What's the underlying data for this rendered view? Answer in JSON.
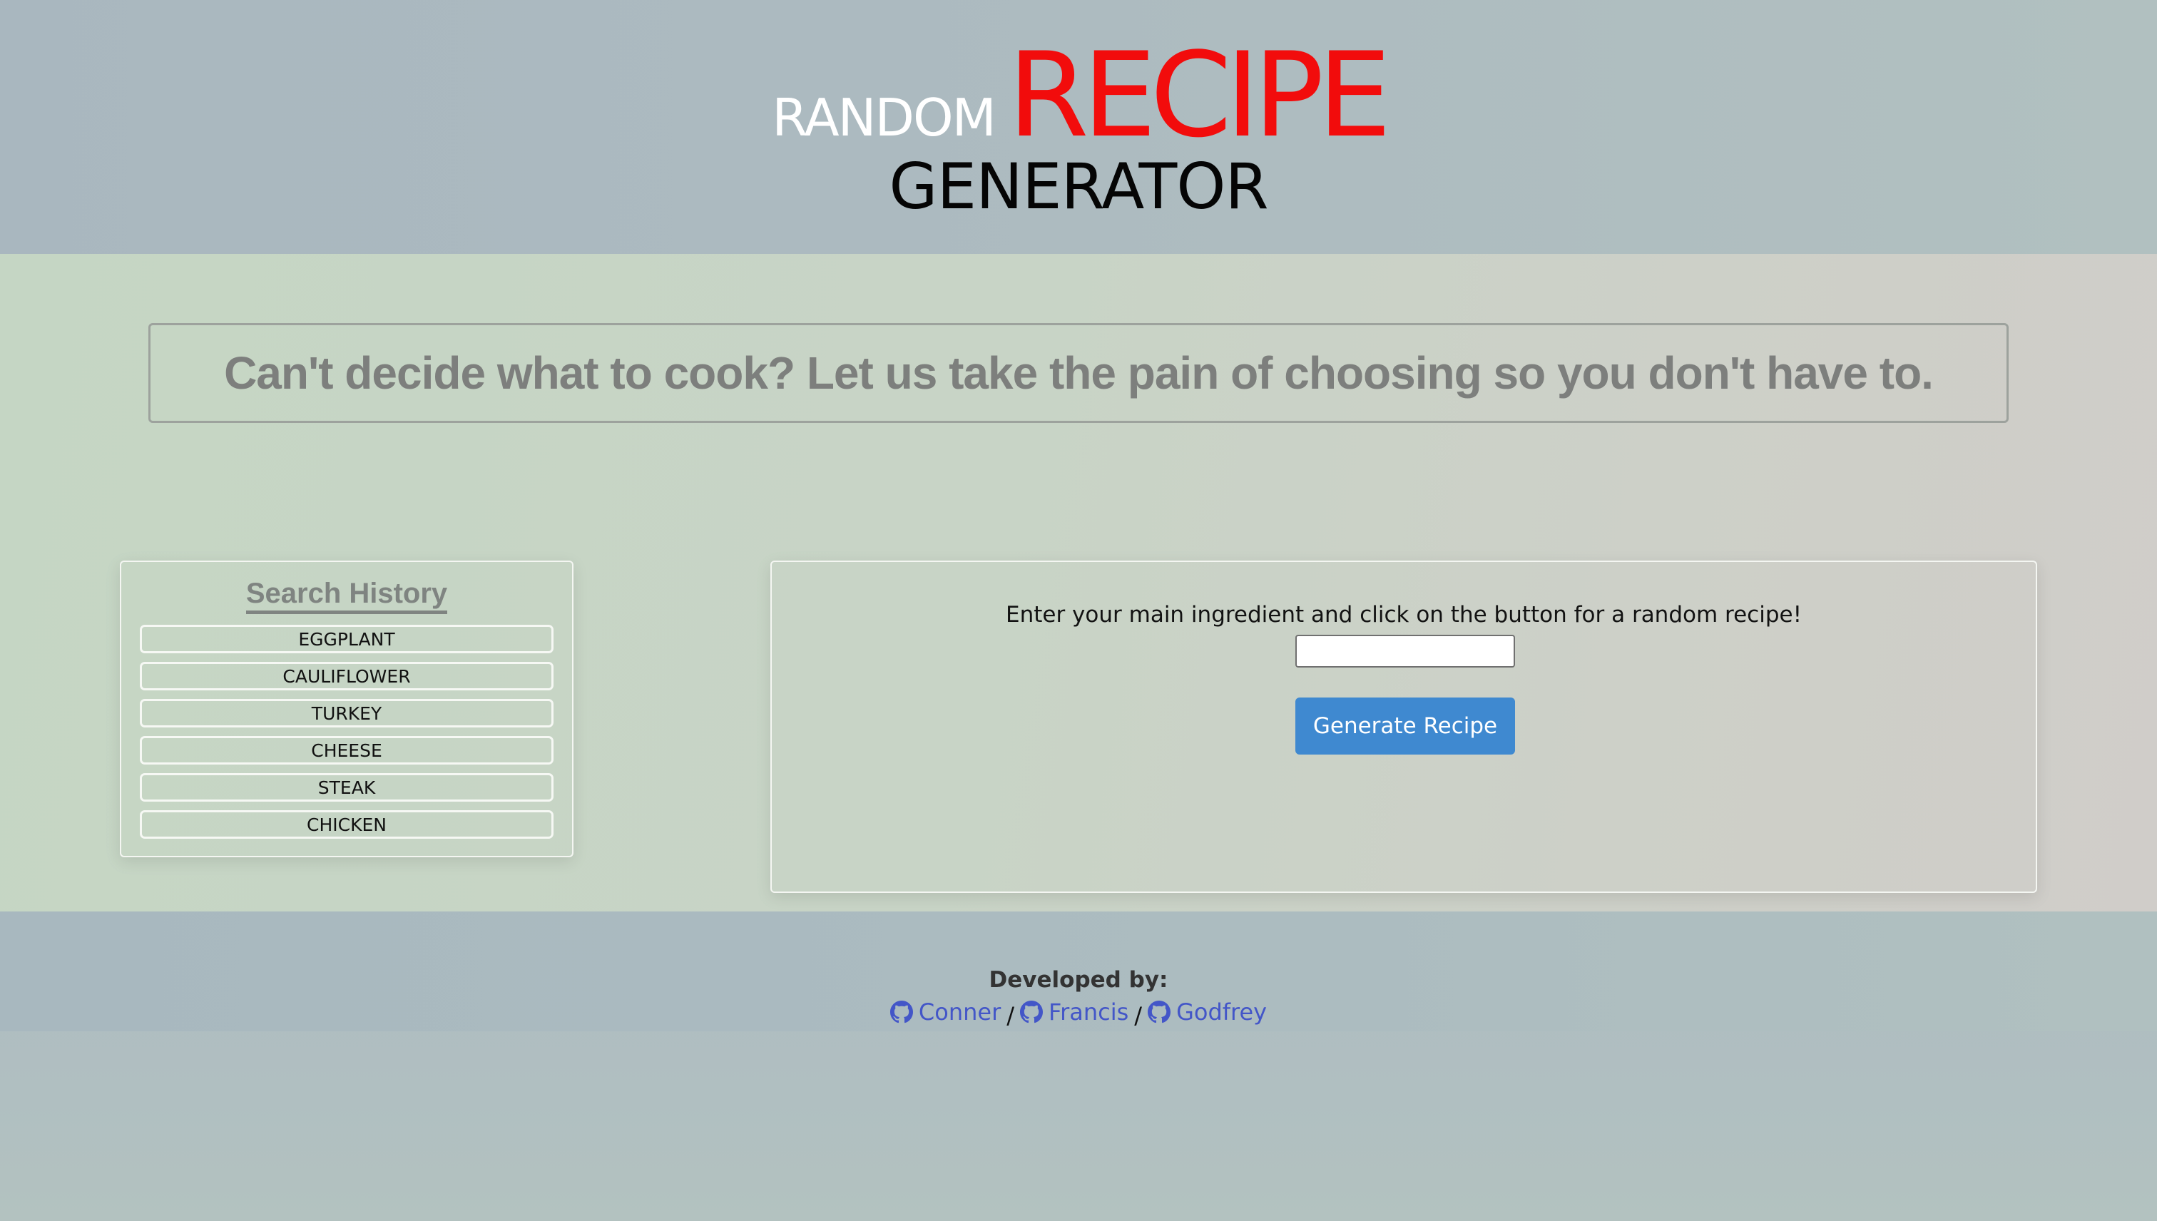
{
  "header": {
    "title_random": "RANDOM",
    "title_recipe": "RECIPE",
    "title_generator": "GENERATOR"
  },
  "tagline": "Can't decide what to cook? Let us take the pain of choosing so you don't have to.",
  "history": {
    "title": "Search History",
    "items": [
      "EGGPLANT",
      "CAULIFLOWER",
      "TURKEY",
      "CHEESE",
      "STEAK",
      "CHICKEN"
    ]
  },
  "generator": {
    "instructions": "Enter your main ingredient and click on the button for a random recipe!",
    "input_value": "",
    "button_label": "Generate Recipe"
  },
  "footer": {
    "developed_by": "Developed by:",
    "developers": [
      {
        "name": "Conner",
        "icon": "github-icon"
      },
      {
        "name": "Francis",
        "icon": "github-icon"
      },
      {
        "name": "Godfrey",
        "icon": "github-icon"
      }
    ],
    "separator": "/"
  },
  "colors": {
    "recipe_red": "#f20c0c",
    "button_blue": "#3f89d0",
    "link_blue": "#4356c8"
  }
}
